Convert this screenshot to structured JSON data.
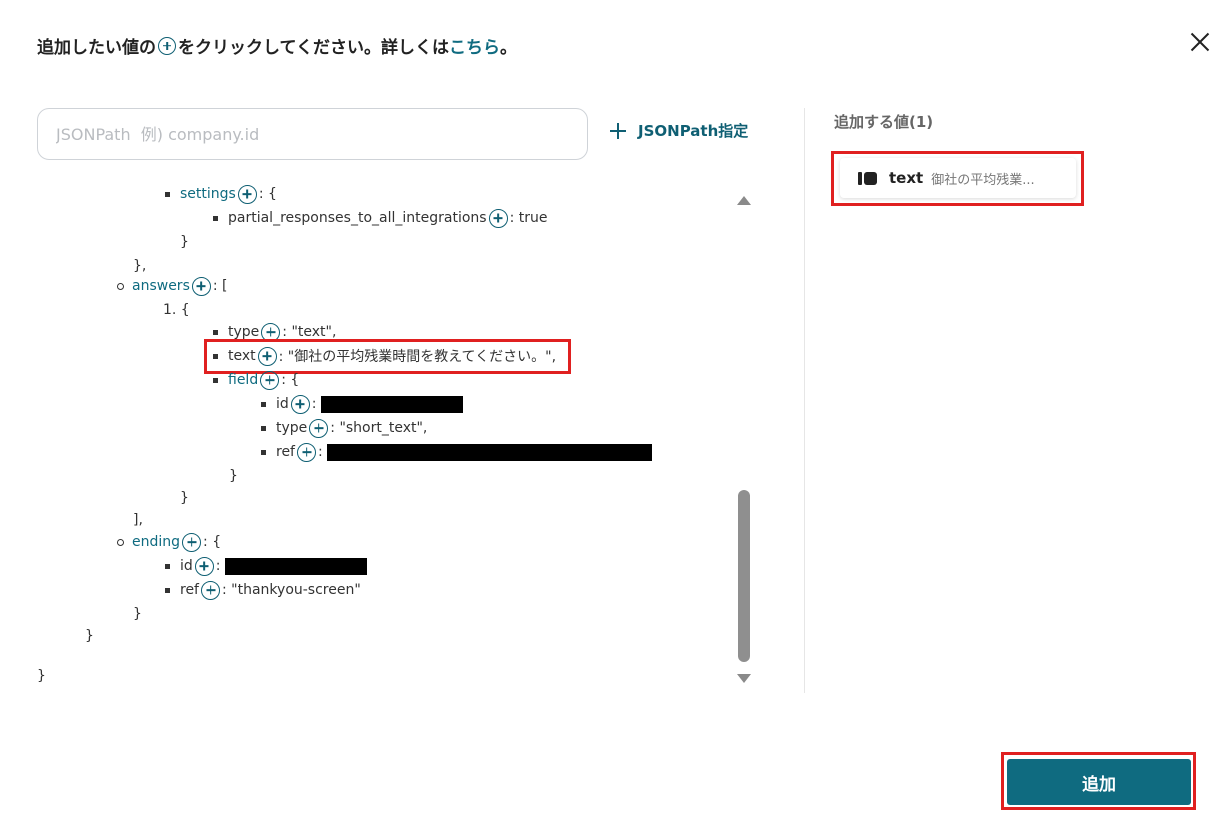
{
  "header": {
    "text_before": "追加したい値の",
    "text_after": "をクリックしてください。詳しくは",
    "link": "こちら",
    "period": "。"
  },
  "search": {
    "placeholder": "JSONPath  例) company.id",
    "value": ""
  },
  "jsonpath_button": {
    "label": "JSONPath指定"
  },
  "tree": {
    "settings_key": "settings",
    "settings_open": ": {",
    "partial_key": "partial_responses_to_all_integrations",
    "partial_val": ": true",
    "close_brace": "}",
    "close_brace_comma": "},",
    "answers_key": "answers",
    "answers_open": ": [",
    "item1_open": "1. {",
    "type_key": "type",
    "type_val": ": \"text\",",
    "text_key": "text",
    "text_val": ": \"御社の平均残業時間を教えてください。\",",
    "field_key": "field",
    "field_open": ": {",
    "id_key": "id",
    "colon": ":",
    "field_type_val": ": \"short_text\",",
    "ref_key": "ref",
    "close_bracket_comma": "],",
    "ending_key": "ending",
    "ending_open": ": {",
    "ending_ref_val": ": \"thankyou-screen\""
  },
  "right": {
    "title": "追加する値(1)",
    "chip": {
      "key": "text",
      "value": "御社の平均残業..."
    }
  },
  "footer": {
    "add_label": "追加"
  },
  "colors": {
    "accent": "#0f6b80",
    "highlight": "#e02020"
  }
}
